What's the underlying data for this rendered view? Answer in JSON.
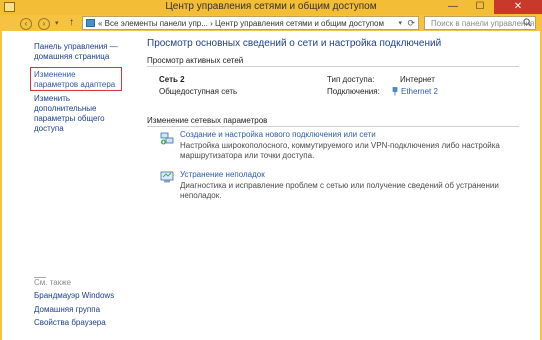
{
  "window": {
    "title": "Центр управления сетями и общим доступом",
    "minimize": "—",
    "maximize": "☐",
    "close": "✕"
  },
  "address_bar": {
    "back": "‹",
    "forward": "›",
    "up": "↑",
    "path": "« Все элементы панели упр... › Центр управления сетями и общим доступом",
    "search_placeholder": "Поиск в панели управления"
  },
  "left_pane": {
    "home_link": "Панель управления — домашняя страница",
    "adapter_link": "Изменение параметров адаптера",
    "sharing_link": "Изменить дополнительные параметры общего доступа",
    "see_also": "См. также",
    "see_also_links": [
      "Брандмауэр Windows",
      "Домашняя группа",
      "Свойства браузера"
    ]
  },
  "main": {
    "title": "Просмотр основных сведений о сети и настройка подключений",
    "active_networks_header": "Просмотр активных сетей",
    "network_name": "Сеть  2",
    "network_category": "Общедоступная сеть",
    "access_type_label": "Тип доступа:",
    "access_type_value": "Интернет",
    "connections_label": "Подключения:",
    "connection_name": "Ethernet 2",
    "change_settings_header": "Изменение сетевых параметров",
    "tasks": [
      {
        "title": "Создание и настройка нового подключения или сети",
        "description": "Настройка широкополосного, коммутируемого или VPN-подключения либо настройка маршрутизатора или точки доступа.",
        "icon": "network-setup-icon"
      },
      {
        "title": "Устранение неполадок",
        "description": "Диагностика и исправление проблем с сетью или получение сведений об устранении неполадок.",
        "icon": "troubleshoot-icon"
      }
    ]
  },
  "colors": {
    "desktop_accent": "#f5c242",
    "link": "#2f5aa8",
    "title_blue": "#1e3f8a",
    "highlight_red": "#d9303a",
    "close_button": "#c7392b"
  }
}
